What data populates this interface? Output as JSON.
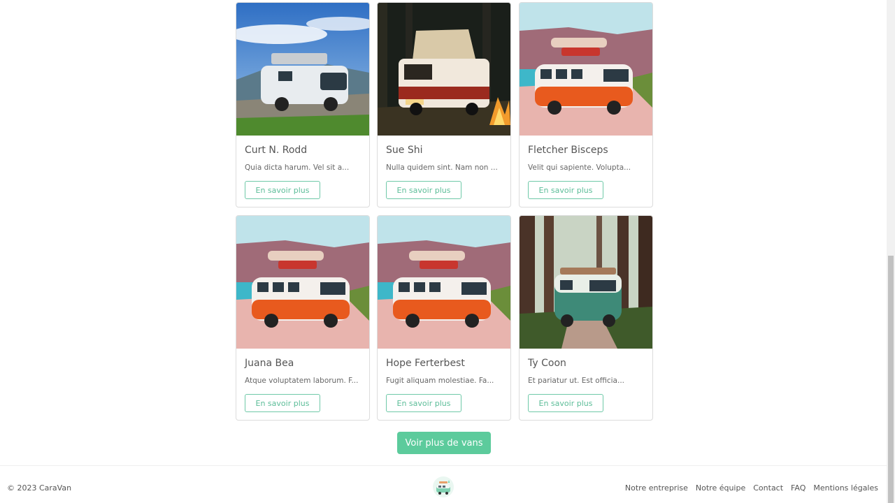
{
  "cards": [
    {
      "name": "Curt N. Rodd",
      "desc": "Quia dicta harum. Vel sit a...",
      "button": "En savoir plus",
      "image": "silver-van-mountains"
    },
    {
      "name": "Sue Shi",
      "desc": "Nulla quidem sint. Nam non ...",
      "button": "En savoir plus",
      "image": "red-van-campfire-night"
    },
    {
      "name": "Fletcher Bisceps",
      "desc": "Velit qui sapiente. Volupta...",
      "button": "En savoir plus",
      "image": "orange-vw-van-desert"
    },
    {
      "name": "Juana Bea",
      "desc": "Atque voluptatem laborum. F...",
      "button": "En savoir plus",
      "image": "orange-vw-van-desert"
    },
    {
      "name": "Hope Ferterbest",
      "desc": "Fugit aliquam molestiae. Fa...",
      "button": "En savoir plus",
      "image": "orange-vw-van-desert"
    },
    {
      "name": "Ty Coon",
      "desc": "Et pariatur ut. Est officia...",
      "button": "En savoir plus",
      "image": "green-vw-van-forest"
    }
  ],
  "more_button": "Voir plus de vans",
  "footer": {
    "copyright": "© 2023 CaraVan",
    "logo": "caravan-logo-icon",
    "links": [
      "Notre entreprise",
      "Notre équipe",
      "Contact",
      "FAQ",
      "Mentions légales"
    ]
  },
  "colors": {
    "accent": "#5ccb9c",
    "accent_outline": "#6fc9a8"
  }
}
